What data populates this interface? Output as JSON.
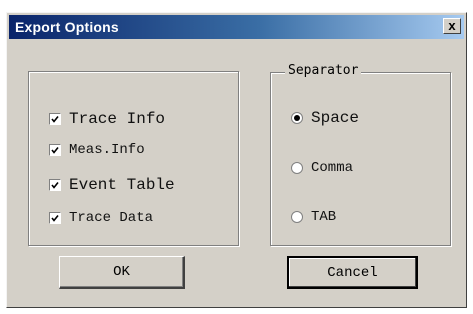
{
  "window": {
    "title": "Export Options",
    "close_label": "x"
  },
  "export_group": {
    "items": [
      {
        "label": "Trace Info",
        "checked": true
      },
      {
        "label": "Meas.Info",
        "checked": true
      },
      {
        "label": "Event Table",
        "checked": true
      },
      {
        "label": "Trace Data",
        "checked": true
      }
    ]
  },
  "separator_group": {
    "legend": "Separator",
    "options": [
      {
        "label": "Space",
        "selected": true
      },
      {
        "label": "Comma",
        "selected": false
      },
      {
        "label": "TAB",
        "selected": false
      }
    ]
  },
  "buttons": {
    "ok_label": "OK",
    "cancel_label": "Cancel"
  }
}
